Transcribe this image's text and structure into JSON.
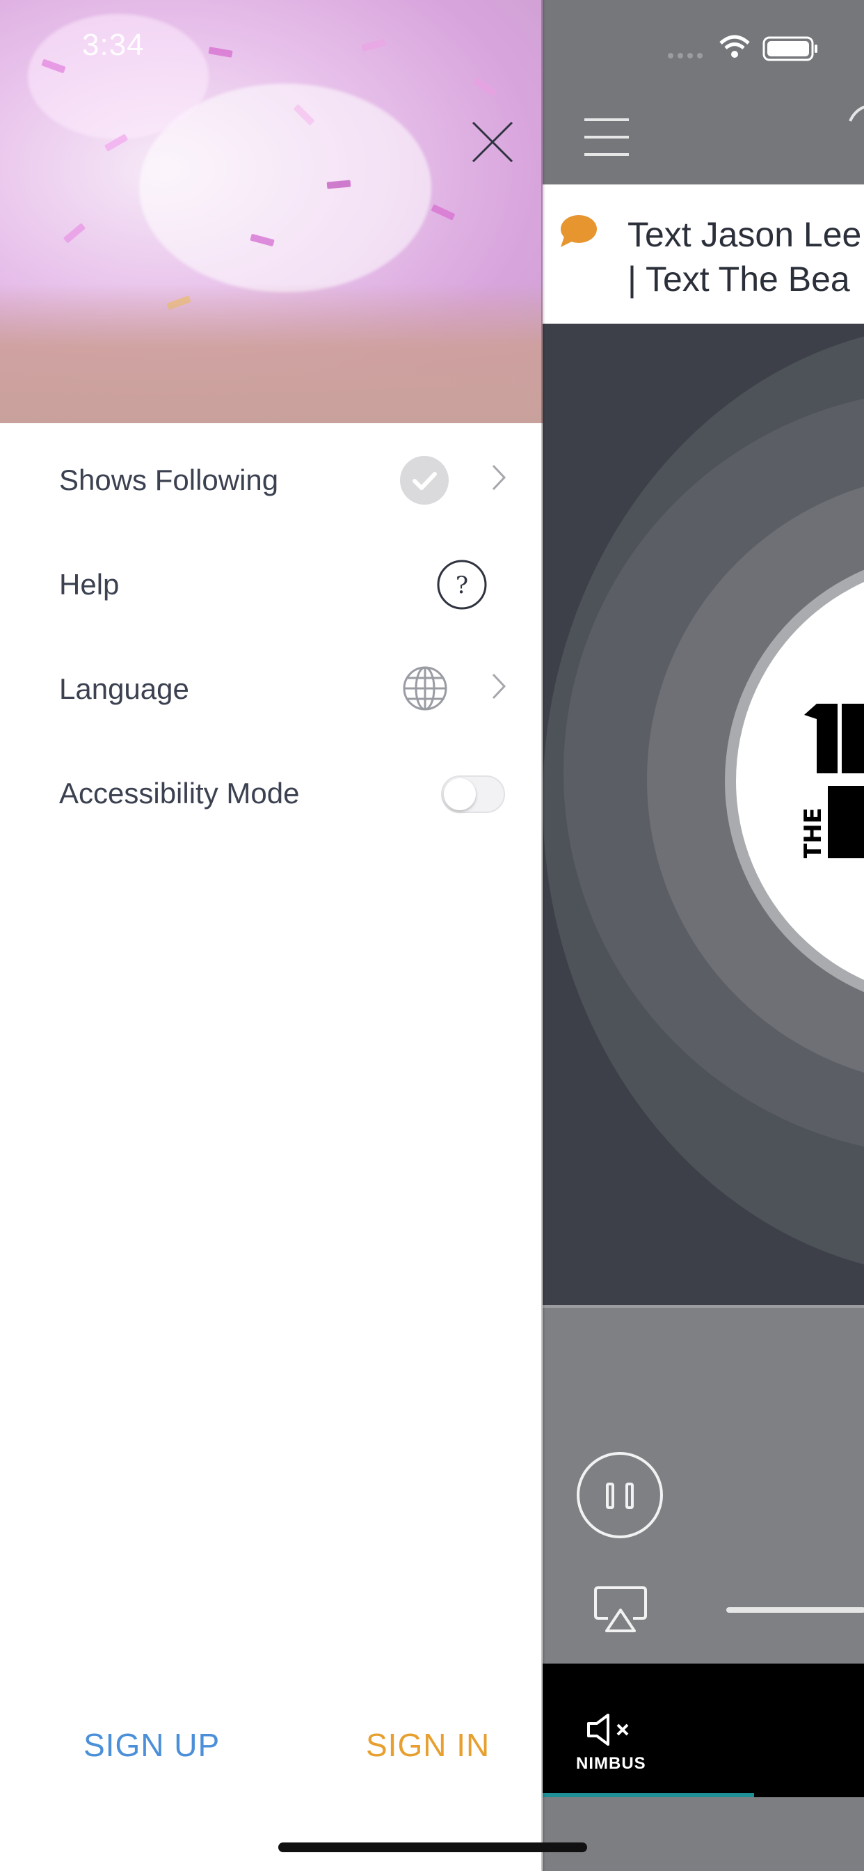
{
  "status_bar": {
    "time": "3:34"
  },
  "drawer": {
    "menu_items": [
      {
        "label": "Shows Following",
        "icon": "check-circle-icon"
      },
      {
        "label": "Help",
        "icon": "question-circle-icon"
      },
      {
        "label": "Language",
        "icon": "globe-icon"
      },
      {
        "label": "Accessibility Mode",
        "icon": "toggle-switch",
        "toggle_on": false
      }
    ],
    "sign_up_label": "SIGN UP",
    "sign_in_label": "SIGN IN",
    "colors": {
      "sign_up": "#4a8fd8",
      "sign_in": "#e7a02f"
    }
  },
  "app": {
    "banner": {
      "icon": "chat-bubble-icon",
      "line1": "Text Jason Lee",
      "line2": "| Text The Bea"
    },
    "bottom_bar": {
      "tab_label": "NIMBUS",
      "tab_icon": "speaker-muted-icon"
    },
    "colors": {
      "accent": "#1d8f95",
      "banner_icon": "#e7952f"
    }
  }
}
